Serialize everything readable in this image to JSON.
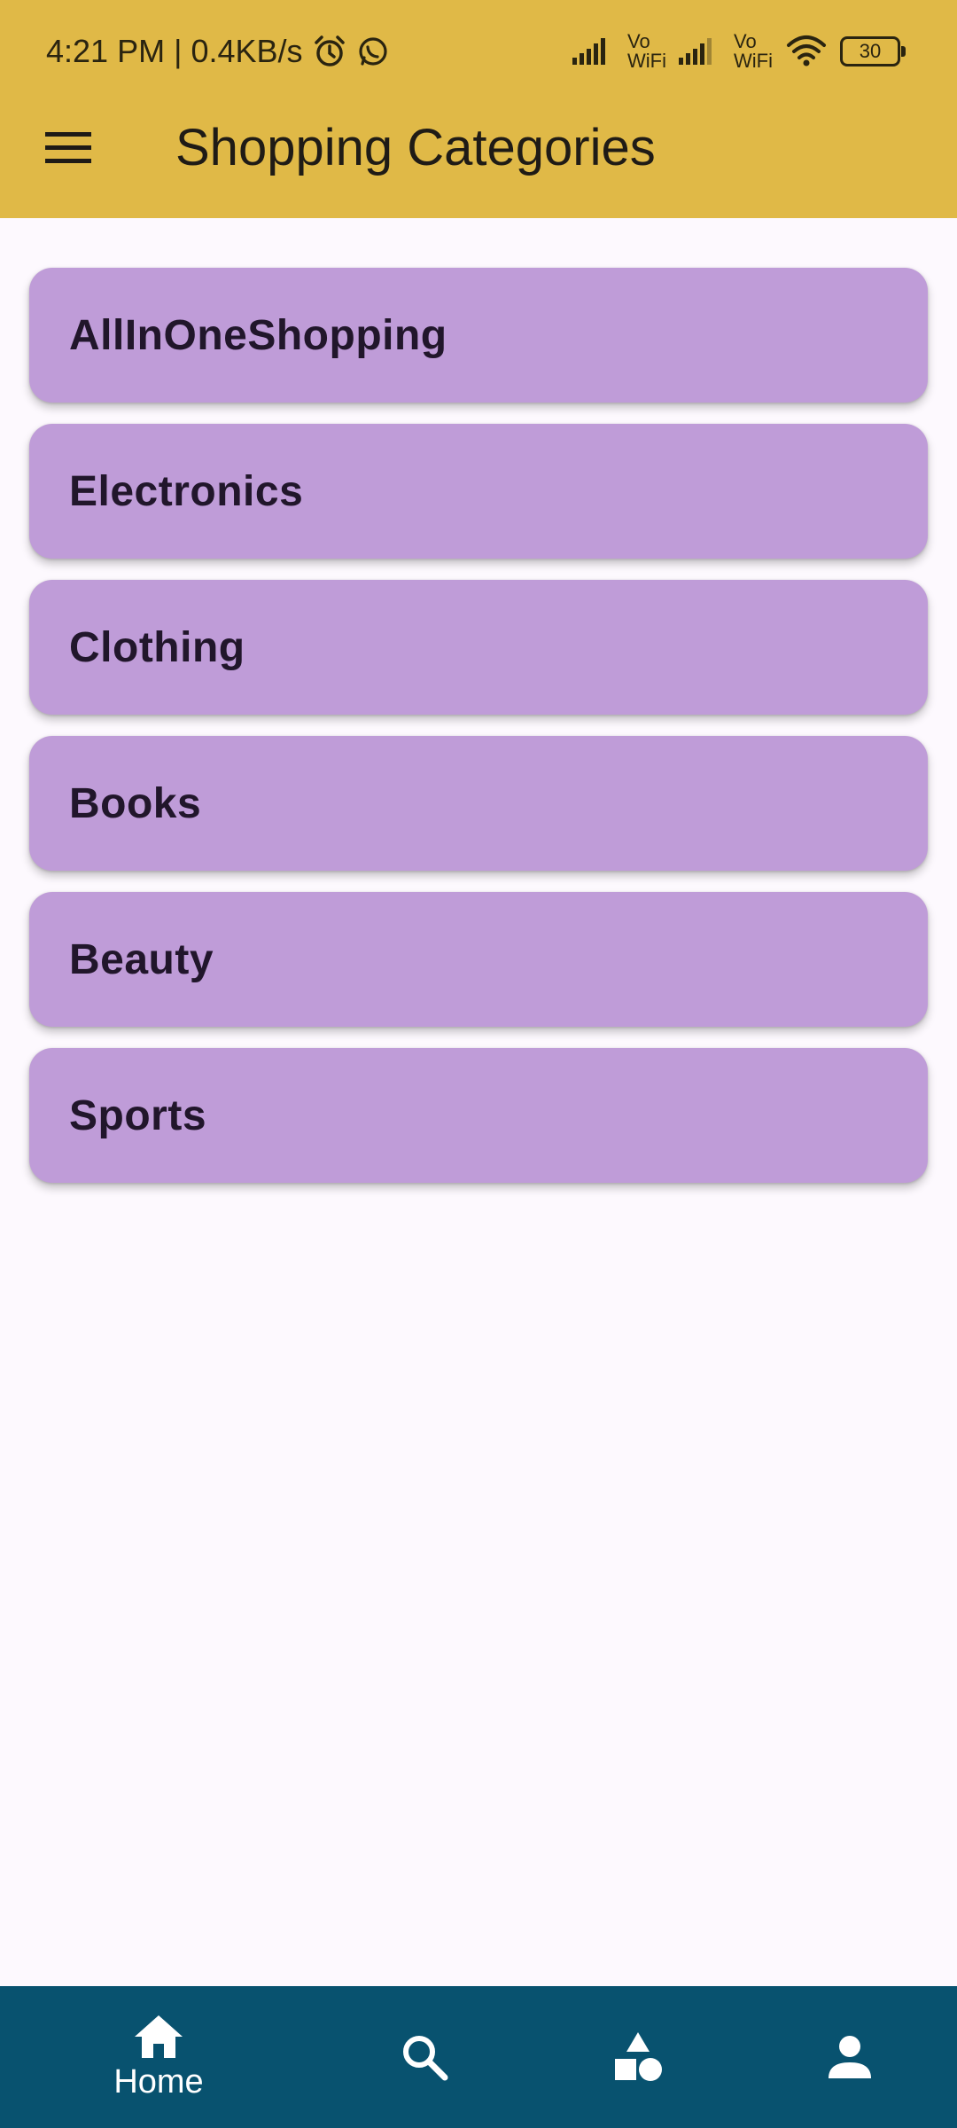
{
  "status_bar": {
    "time": "4:21 PM",
    "separator": "|",
    "speed": "0.4KB/s",
    "vo_label": "Vo",
    "wifi_label": "WiFi",
    "battery": "30"
  },
  "app_bar": {
    "title": "Shopping Categories",
    "background": "#e0b947"
  },
  "categories": [
    {
      "label": "AllInOneShopping"
    },
    {
      "label": "Electronics"
    },
    {
      "label": "Clothing"
    },
    {
      "label": "Books"
    },
    {
      "label": "Beauty"
    },
    {
      "label": "Sports"
    }
  ],
  "card_color": "#bf9cd8",
  "bottom_nav": {
    "background": "#08526f",
    "items": [
      {
        "icon": "home-icon",
        "label": "Home",
        "selected": true
      },
      {
        "icon": "search-icon",
        "label": "",
        "selected": false
      },
      {
        "icon": "categories-icon",
        "label": "",
        "selected": false
      },
      {
        "icon": "person-icon",
        "label": "",
        "selected": false
      }
    ]
  }
}
